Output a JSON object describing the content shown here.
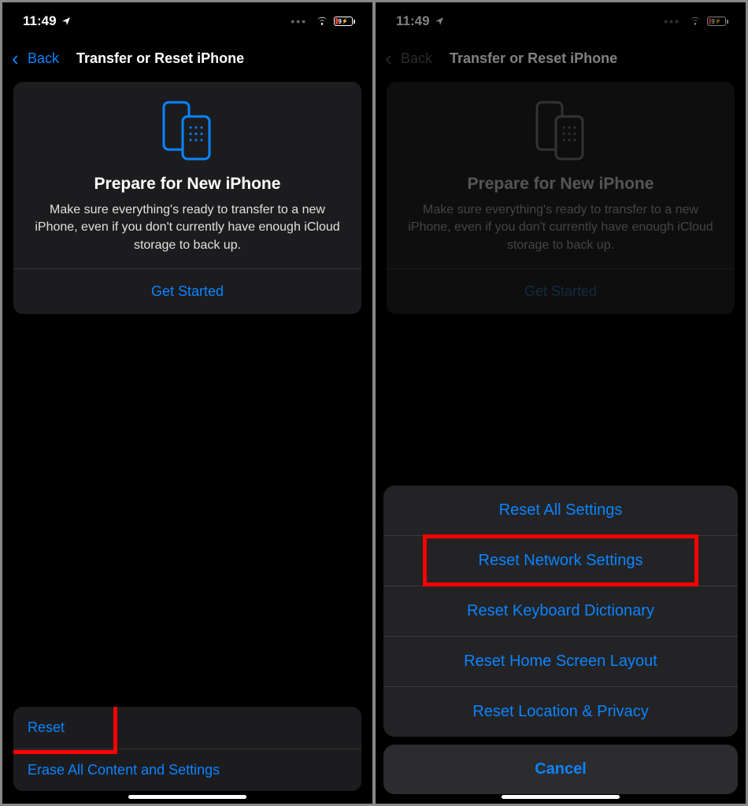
{
  "left": {
    "status": {
      "time": "11:49",
      "battery_text": "9"
    },
    "nav": {
      "back": "Back",
      "title": "Transfer or Reset iPhone"
    },
    "prepare": {
      "title": "Prepare for New iPhone",
      "desc": "Make sure everything's ready to transfer to a new iPhone, even if you don't currently have enough iCloud storage to back up.",
      "action": "Get Started"
    },
    "bottom": {
      "reset": "Reset",
      "erase": "Erase All Content and Settings"
    }
  },
  "right": {
    "status": {
      "time": "11:49",
      "battery_text": "9"
    },
    "nav": {
      "back": "Back",
      "title": "Transfer or Reset iPhone"
    },
    "prepare": {
      "title": "Prepare for New iPhone",
      "desc": "Make sure everything's ready to transfer to a new iPhone, even if you don't currently have enough iCloud storage to back up.",
      "action": "Get Started"
    },
    "sheet": {
      "items": [
        "Reset All Settings",
        "Reset Network Settings",
        "Reset Keyboard Dictionary",
        "Reset Home Screen Layout",
        "Reset Location & Privacy"
      ],
      "cancel": "Cancel"
    }
  }
}
